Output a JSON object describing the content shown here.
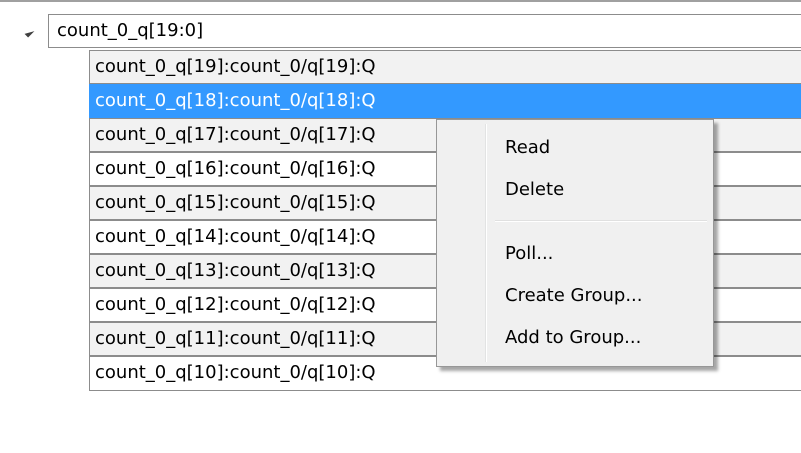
{
  "tree": {
    "group": {
      "expander_icon": "triangle-expanded-icon",
      "label": "count_0_q[19:0]"
    },
    "items": [
      {
        "label": "count_0_q[19]:count_0/q[19]:Q"
      },
      {
        "label": "count_0_q[18]:count_0/q[18]:Q",
        "selected": true
      },
      {
        "label": "count_0_q[17]:count_0/q[17]:Q"
      },
      {
        "label": "count_0_q[16]:count_0/q[16]:Q"
      },
      {
        "label": "count_0_q[15]:count_0/q[15]:Q"
      },
      {
        "label": "count_0_q[14]:count_0/q[14]:Q"
      },
      {
        "label": "count_0_q[13]:count_0/q[13]:Q"
      },
      {
        "label": "count_0_q[12]:count_0/q[12]:Q"
      },
      {
        "label": "count_0_q[11]:count_0/q[11]:Q"
      },
      {
        "label": "count_0_q[10]:count_0/q[10]:Q"
      }
    ]
  },
  "context_menu": {
    "items": [
      {
        "label": "Read"
      },
      {
        "label": "Delete"
      },
      {
        "label": "Poll..."
      },
      {
        "label": "Create Group..."
      },
      {
        "label": "Add to Group..."
      }
    ]
  },
  "colors": {
    "selection": "#3399ff",
    "row_alt": "#f2f2f2",
    "menu_bg": "#f0f0f0",
    "border": "#8c8c8c"
  }
}
